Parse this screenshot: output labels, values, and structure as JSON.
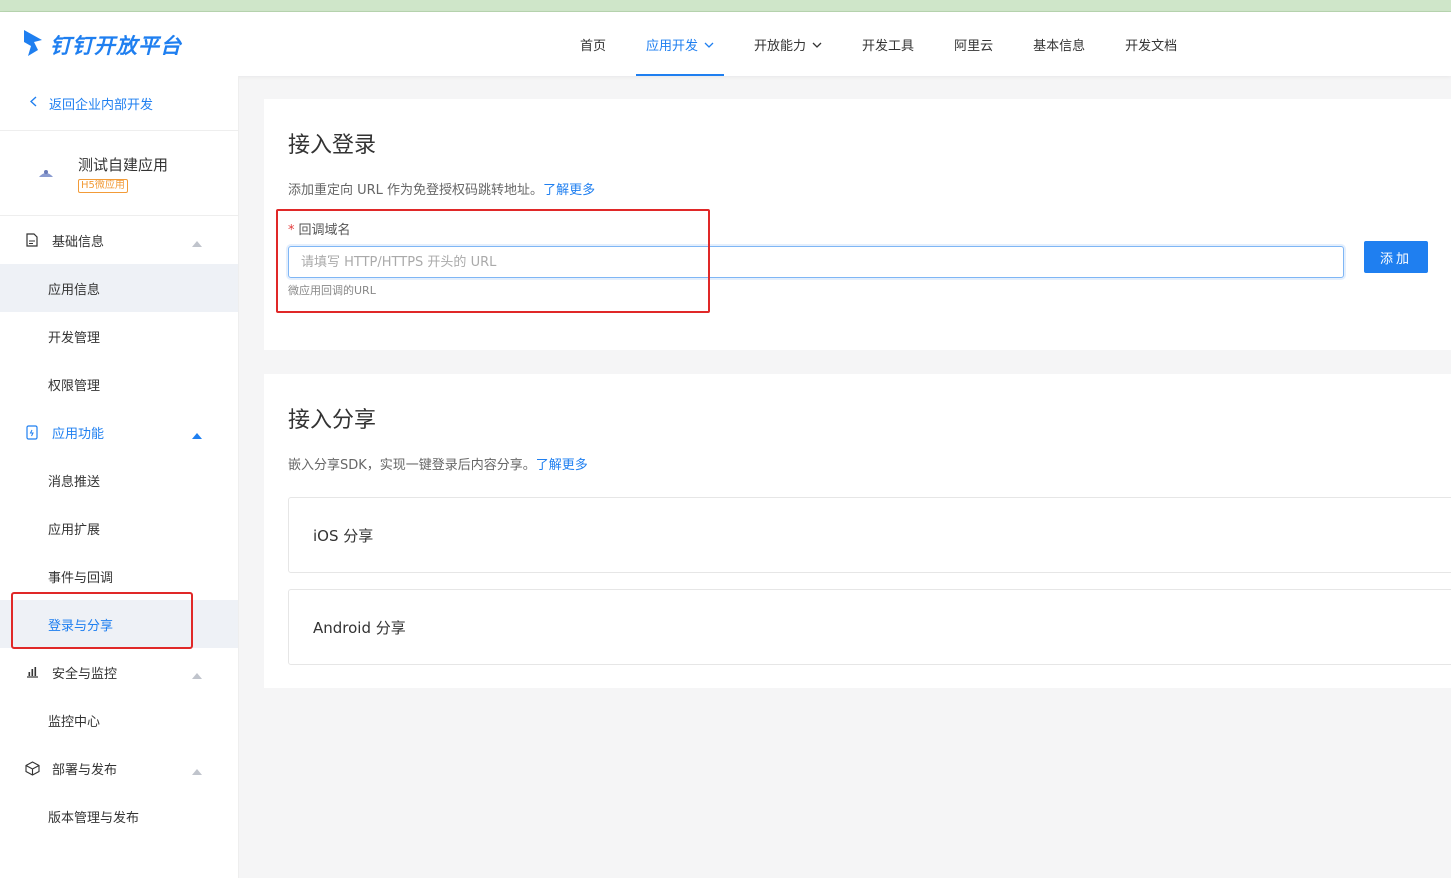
{
  "header": {
    "logo_text": "钉钉开放平台",
    "nav": [
      {
        "label": "首页",
        "active": false,
        "has_dropdown": false
      },
      {
        "label": "应用开发",
        "active": true,
        "has_dropdown": true
      },
      {
        "label": "开放能力",
        "active": false,
        "has_dropdown": true
      },
      {
        "label": "开发工具",
        "active": false,
        "has_dropdown": false
      },
      {
        "label": "阿里云",
        "active": false,
        "has_dropdown": false
      },
      {
        "label": "基本信息",
        "active": false,
        "has_dropdown": false
      },
      {
        "label": "开发文档",
        "active": false,
        "has_dropdown": false
      }
    ]
  },
  "sidebar": {
    "back_label": "返回企业内部开发",
    "app": {
      "name": "测试自建应用",
      "tag": "H5微应用"
    },
    "groups": [
      {
        "label": "基础信息",
        "icon": "document-icon",
        "items": [
          "应用信息",
          "开发管理",
          "权限管理"
        ]
      },
      {
        "label": "应用功能",
        "icon": "phone-icon",
        "items": [
          "消息推送",
          "应用扩展",
          "事件与回调",
          "登录与分享"
        ]
      },
      {
        "label": "安全与监控",
        "icon": "chart-icon",
        "items": [
          "监控中心"
        ]
      },
      {
        "label": "部署与发布",
        "icon": "cube-icon",
        "items": [
          "版本管理与发布"
        ]
      }
    ]
  },
  "login": {
    "title": "接入登录",
    "desc": "添加重定向 URL 作为免登授权码跳转地址。",
    "learn_more": "了解更多",
    "field_required": "*",
    "field_label": "回调域名",
    "placeholder": "请填写 HTTP/HTTPS 开头的 URL",
    "value": "",
    "hint": "微应用回调的URL",
    "add_button": "添加"
  },
  "share": {
    "title": "接入分享",
    "desc": "嵌入分享SDK，实现一键登录后内容分享。",
    "learn_more": "了解更多",
    "items": [
      "iOS 分享",
      "Android 分享"
    ]
  },
  "colors": {
    "accent": "#1f7ff0",
    "highlight": "#e02828",
    "tag": "#f29b38"
  }
}
